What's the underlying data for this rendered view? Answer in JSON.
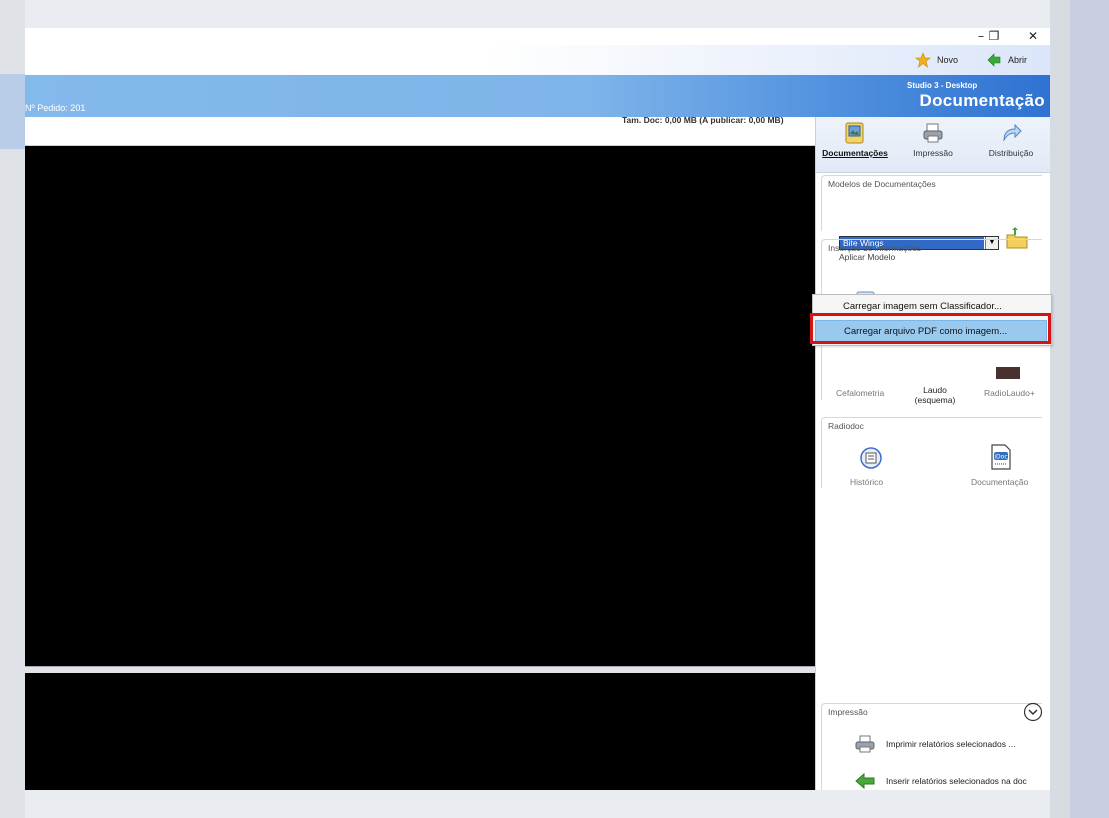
{
  "window": {
    "controls": {
      "minimize": "–",
      "restore": "❐",
      "close": "✕"
    }
  },
  "toolbar": {
    "new_label": "Novo",
    "open_label": "Abrir"
  },
  "header": {
    "order_label": "Nº Pedido: 201",
    "studio_label": "Studio 3 - Desktop",
    "page_title": "Documentação"
  },
  "status": {
    "doc_size": "Tam. Doc: 0,00 MB (A publicar: 0,00 MB)"
  },
  "tabs": [
    {
      "label": "Documentações",
      "icon": "documents-icon"
    },
    {
      "label": "Impressão",
      "icon": "printer-icon"
    },
    {
      "label": "Distribuição",
      "icon": "share-icon"
    }
  ],
  "modelos": {
    "group_label": "Modelos de Documentações",
    "selected_value": "Bite Wings",
    "apply_label": "Aplicar Modelo"
  },
  "insercao": {
    "group_label": "Inserção de informações",
    "items": [
      "Cefalometria",
      "Laudo (esquema)",
      "RadioLaudo+"
    ]
  },
  "context_menu": {
    "items": [
      "Carregar imagem sem Classificador...",
      "Carregar arquivo PDF como imagem..."
    ]
  },
  "radiodoc": {
    "group_label": "Radiodoc",
    "items": [
      "Histórico",
      "Documentação"
    ]
  },
  "impressao": {
    "group_label": "Impressão",
    "actions": [
      "Imprimir relatórios selecionados ...",
      "Inserir relatórios selecionados na doc"
    ]
  },
  "colors": {
    "header_blue": "#4e8fde",
    "selection_blue": "#3169c6",
    "highlight_red": "#d21414"
  }
}
